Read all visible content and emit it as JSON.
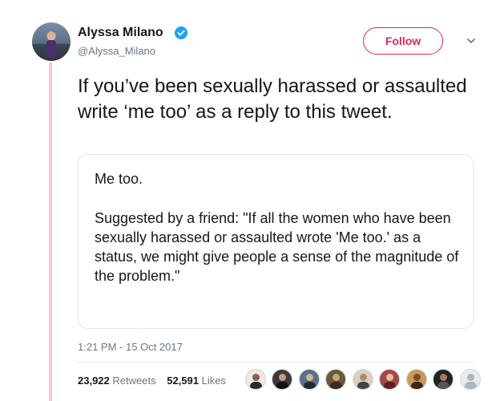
{
  "author": {
    "name": "Alyssa Milano",
    "handle": "@Alyssa_Milano",
    "verified": true
  },
  "follow_button": {
    "label": "Follow"
  },
  "tweet": {
    "text": "If you’ve been sexually harassed or assaulted write ‘me too’ as a reply to this tweet."
  },
  "quote": {
    "line1": "Me too.",
    "body": "Suggested by a friend: \"If all the women who have been sexually harassed or assaulted wrote 'Me too.' as a status, we might give people a sense of the magnitude of the problem.\""
  },
  "timestamp": "1:21 PM - 15 Oct 2017",
  "stats": {
    "retweets_count": "23,922",
    "retweets_label": "Retweets",
    "likes_count": "52,591",
    "likes_label": "Likes"
  },
  "colors": {
    "accent": "#e0245e",
    "verified": "#1da1f2",
    "muted": "#657786",
    "thread_line": "#f5c6d2"
  },
  "icons": {
    "verified": "verified-badge-icon",
    "more": "chevron-down-icon"
  }
}
